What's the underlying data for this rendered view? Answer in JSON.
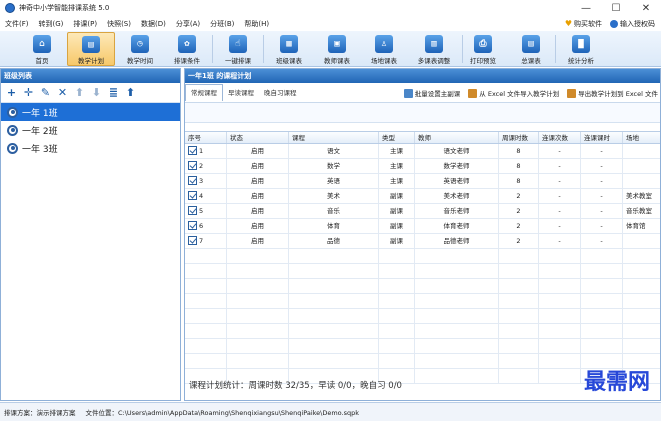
{
  "window": {
    "title": "神奇中小学智能排课系统 5.0",
    "controls": [
      "—",
      "☐",
      "✕"
    ]
  },
  "menu": {
    "items": [
      "文件(F)",
      "转到(G)",
      "排课(P)",
      "快照(S)",
      "数据(D)",
      "分享(A)",
      "分班(B)",
      "帮助(H)"
    ],
    "buy_label": "购买软件",
    "auth_label": "输入授权码"
  },
  "toolbar": {
    "buttons": [
      {
        "label": "首页",
        "icon": "home-icon",
        "glyph": "⌂"
      },
      {
        "label": "教学计划",
        "icon": "clipboard-icon",
        "glyph": "▤"
      },
      {
        "label": "教学时间",
        "icon": "clock-icon",
        "glyph": "◷"
      },
      {
        "label": "排课条件",
        "icon": "condition-icon",
        "glyph": "✿"
      },
      {
        "label": "一键排课",
        "icon": "one-click-icon",
        "glyph": "☝"
      },
      {
        "label": "班级课表",
        "icon": "class-table-icon",
        "glyph": "▦"
      },
      {
        "label": "教师课表",
        "icon": "teacher-table-icon",
        "glyph": "▣"
      },
      {
        "label": "场地课表",
        "icon": "venue-table-icon",
        "glyph": "♙"
      },
      {
        "label": "多课表调整",
        "icon": "multi-adjust-icon",
        "glyph": "▥"
      },
      {
        "label": "打印预览",
        "icon": "print-icon",
        "glyph": "⎙"
      },
      {
        "label": "总课表",
        "icon": "master-table-icon",
        "glyph": "▤"
      },
      {
        "label": "统计分析",
        "icon": "stats-icon",
        "glyph": "▇"
      }
    ]
  },
  "left_pane": {
    "header": "班级列表",
    "tools": [
      "+",
      "✛",
      "✎",
      "✕",
      "⬆",
      "⬇",
      "≣",
      "⬆"
    ],
    "classes": [
      "一年 1班",
      "一年 2班",
      "一年 3班"
    ]
  },
  "right_pane": {
    "header": "一年1班 的课程计划",
    "tabs": [
      "常规课程",
      "早读课程",
      "晚自习课程"
    ],
    "actions": [
      "批量设置主副课",
      "从 Excel 文件导入教学计划",
      "导出教学计划到 Excel 文件"
    ],
    "columns": [
      "序号",
      "状态",
      "课程",
      "类型",
      "教师",
      "周课时数",
      "连课次数",
      "连课课时",
      "场地"
    ],
    "rows": [
      {
        "no": "1",
        "status": "启用",
        "course": "语文",
        "type": "主课",
        "teacher": "语文老师",
        "hours": "8",
        "consec_times": "-",
        "consec_hours": "-",
        "venue": ""
      },
      {
        "no": "2",
        "status": "启用",
        "course": "数学",
        "type": "主课",
        "teacher": "数学老师",
        "hours": "8",
        "consec_times": "-",
        "consec_hours": "-",
        "venue": ""
      },
      {
        "no": "3",
        "status": "启用",
        "course": "英语",
        "type": "主课",
        "teacher": "英语老师",
        "hours": "8",
        "consec_times": "-",
        "consec_hours": "-",
        "venue": ""
      },
      {
        "no": "4",
        "status": "启用",
        "course": "美术",
        "type": "副课",
        "teacher": "美术老师",
        "hours": "2",
        "consec_times": "-",
        "consec_hours": "-",
        "venue": "美术教室"
      },
      {
        "no": "5",
        "status": "启用",
        "course": "音乐",
        "type": "副课",
        "teacher": "音乐老师",
        "hours": "2",
        "consec_times": "-",
        "consec_hours": "-",
        "venue": "音乐教室"
      },
      {
        "no": "6",
        "status": "启用",
        "course": "体育",
        "type": "副课",
        "teacher": "体育老师",
        "hours": "2",
        "consec_times": "-",
        "consec_hours": "-",
        "venue": "体育馆"
      },
      {
        "no": "7",
        "status": "启用",
        "course": "品德",
        "type": "副课",
        "teacher": "品德老师",
        "hours": "2",
        "consec_times": "-",
        "consec_hours": "-",
        "venue": ""
      }
    ],
    "summary": "课程计划统计：周课时数 32/35，早读 0/0，晚自习 0/0"
  },
  "watermark": "最需网",
  "status_bar": {
    "plan": "排课方案：演示排课方案",
    "file": "文件位置：C:\\Users\\admin\\AppData\\Roaming\\Shenqixiangsu\\ShenqiPaike\\Demo.sqpk"
  }
}
